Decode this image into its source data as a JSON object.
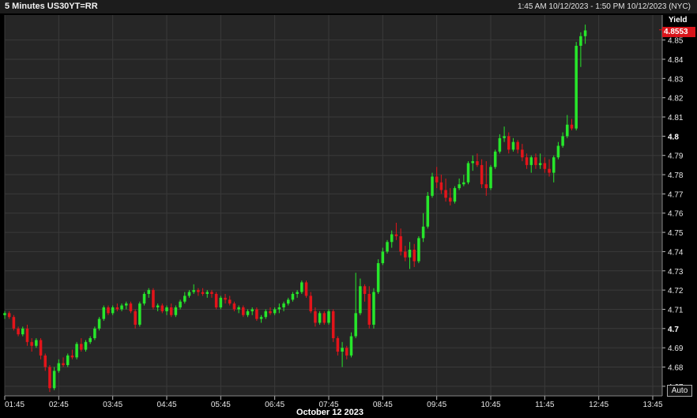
{
  "header": {
    "title": "5 Minutes US30YT=RR",
    "range": "1:45 AM 10/12/2023 - 1:50 PM 10/12/2023 (NYC)"
  },
  "axis": {
    "y_title": "Yield",
    "date_label": "October 12 2023",
    "auto_label": "Auto"
  },
  "last_price": {
    "value": "4.8553",
    "color": "#d9141a"
  },
  "colors": {
    "up": "#27e62b",
    "down": "#e3141a",
    "grid": "#3a3a3a",
    "plot_bg": "#262626"
  },
  "chart_data": {
    "type": "candlestick",
    "title": "5 Minutes US30YT=RR",
    "ylabel": "Yield",
    "xlabel": "October 12 2023",
    "ylim": [
      4.665,
      4.863
    ],
    "y_ticks": [
      "4.67",
      "4.68",
      "4.69",
      "4.7",
      "4.71",
      "4.72",
      "4.73",
      "4.74",
      "4.75",
      "4.76",
      "4.77",
      "4.78",
      "4.79",
      "4.8",
      "4.81",
      "4.82",
      "4.83",
      "4.84",
      "4.85"
    ],
    "x_ticks": [
      "01:45",
      "02:45",
      "03:45",
      "04:45",
      "05:45",
      "06:45",
      "07:45",
      "08:45",
      "09:45",
      "10:45",
      "11:45",
      "12:45",
      "13:45"
    ],
    "start_time": "01:45",
    "interval_minutes": 5,
    "candles": [
      [
        4.707,
        4.709,
        4.705,
        4.708
      ],
      [
        4.708,
        4.709,
        4.705,
        4.706
      ],
      [
        4.706,
        4.707,
        4.699,
        4.7
      ],
      [
        4.7,
        4.701,
        4.696,
        4.697
      ],
      [
        4.697,
        4.701,
        4.696,
        4.7
      ],
      [
        4.7,
        4.702,
        4.691,
        4.693
      ],
      [
        4.693,
        4.695,
        4.688,
        4.691
      ],
      [
        4.691,
        4.695,
        4.69,
        4.694
      ],
      [
        4.694,
        4.695,
        4.684,
        4.686
      ],
      [
        4.686,
        4.687,
        4.678,
        4.68
      ],
      [
        4.68,
        4.681,
        4.667,
        4.669
      ],
      [
        4.669,
        4.68,
        4.668,
        4.678
      ],
      [
        4.678,
        4.684,
        4.677,
        4.682
      ],
      [
        4.682,
        4.685,
        4.68,
        4.681
      ],
      [
        4.681,
        4.687,
        4.68,
        4.686
      ],
      [
        4.686,
        4.689,
        4.684,
        4.685
      ],
      [
        4.685,
        4.693,
        4.684,
        4.692
      ],
      [
        4.692,
        4.695,
        4.688,
        4.689
      ],
      [
        4.689,
        4.694,
        4.688,
        4.693
      ],
      [
        4.693,
        4.696,
        4.692,
        4.695
      ],
      [
        4.695,
        4.701,
        4.694,
        4.7
      ],
      [
        4.7,
        4.706,
        4.699,
        4.705
      ],
      [
        4.705,
        4.712,
        4.704,
        4.711
      ],
      [
        4.711,
        4.712,
        4.707,
        4.708
      ],
      [
        4.708,
        4.712,
        4.707,
        4.711
      ],
      [
        4.711,
        4.713,
        4.709,
        4.71
      ],
      [
        4.71,
        4.713,
        4.709,
        4.712
      ],
      [
        4.712,
        4.714,
        4.71,
        4.713
      ],
      [
        4.713,
        4.714,
        4.708,
        4.709
      ],
      [
        4.709,
        4.71,
        4.7,
        4.702
      ],
      [
        4.702,
        4.714,
        4.701,
        4.713
      ],
      [
        4.713,
        4.719,
        4.712,
        4.718
      ],
      [
        4.718,
        4.721,
        4.716,
        4.72
      ],
      [
        4.72,
        4.721,
        4.71,
        4.711
      ],
      [
        4.711,
        4.713,
        4.709,
        4.712
      ],
      [
        4.712,
        4.713,
        4.708,
        4.709
      ],
      [
        4.709,
        4.712,
        4.707,
        4.711
      ],
      [
        4.711,
        4.713,
        4.706,
        4.707
      ],
      [
        4.707,
        4.712,
        4.706,
        4.711
      ],
      [
        4.711,
        4.715,
        4.71,
        4.714
      ],
      [
        4.714,
        4.719,
        4.713,
        4.717
      ],
      [
        4.717,
        4.72,
        4.716,
        4.719
      ],
      [
        4.719,
        4.723,
        4.718,
        4.72
      ],
      [
        4.72,
        4.721,
        4.717,
        4.719
      ],
      [
        4.719,
        4.721,
        4.717,
        4.718
      ],
      [
        4.718,
        4.72,
        4.716,
        4.719
      ],
      [
        4.719,
        4.72,
        4.716,
        4.718
      ],
      [
        4.718,
        4.719,
        4.71,
        4.711
      ],
      [
        4.711,
        4.717,
        4.71,
        4.716
      ],
      [
        4.716,
        4.718,
        4.713,
        4.715
      ],
      [
        4.715,
        4.717,
        4.712,
        4.713
      ],
      [
        4.713,
        4.714,
        4.709,
        4.71
      ],
      [
        4.71,
        4.712,
        4.708,
        4.711
      ],
      [
        4.711,
        4.712,
        4.706,
        4.707
      ],
      [
        4.707,
        4.71,
        4.706,
        4.709
      ],
      [
        4.709,
        4.711,
        4.707,
        4.71
      ],
      [
        4.71,
        4.711,
        4.704,
        4.705
      ],
      [
        4.705,
        4.707,
        4.703,
        4.706
      ],
      [
        4.706,
        4.71,
        4.705,
        4.709
      ],
      [
        4.709,
        4.711,
        4.707,
        4.708
      ],
      [
        4.708,
        4.711,
        4.707,
        4.71
      ],
      [
        4.71,
        4.713,
        4.708,
        4.711
      ],
      [
        4.711,
        4.714,
        4.709,
        4.713
      ],
      [
        4.713,
        4.716,
        4.712,
        4.715
      ],
      [
        4.715,
        4.719,
        4.714,
        4.718
      ],
      [
        4.718,
        4.72,
        4.716,
        4.719
      ],
      [
        4.719,
        4.725,
        4.718,
        4.724
      ],
      [
        4.724,
        4.725,
        4.716,
        4.717
      ],
      [
        4.717,
        4.719,
        4.708,
        4.709
      ],
      [
        4.709,
        4.711,
        4.701,
        4.703
      ],
      [
        4.703,
        4.709,
        4.702,
        4.708
      ],
      [
        4.708,
        4.709,
        4.702,
        4.703
      ],
      [
        4.703,
        4.71,
        4.702,
        4.709
      ],
      [
        4.709,
        4.71,
        4.693,
        4.695
      ],
      [
        4.695,
        4.696,
        4.686,
        4.688
      ],
      [
        4.688,
        4.693,
        4.68,
        4.69
      ],
      [
        4.69,
        4.691,
        4.684,
        4.686
      ],
      [
        4.686,
        4.698,
        4.685,
        4.696
      ],
      [
        4.696,
        4.729,
        4.695,
        4.708
      ],
      [
        4.708,
        4.726,
        4.707,
        4.722
      ],
      [
        4.722,
        4.723,
        4.714,
        4.718
      ],
      [
        4.718,
        4.722,
        4.7,
        4.702
      ],
      [
        4.702,
        4.721,
        4.7,
        4.719
      ],
      [
        4.719,
        4.736,
        4.718,
        4.734
      ],
      [
        4.734,
        4.742,
        4.733,
        4.74
      ],
      [
        4.74,
        4.746,
        4.739,
        4.745
      ],
      [
        4.745,
        4.751,
        4.742,
        4.749
      ],
      [
        4.749,
        4.755,
        4.746,
        4.748
      ],
      [
        4.748,
        4.752,
        4.738,
        4.74
      ],
      [
        4.74,
        4.743,
        4.735,
        4.737
      ],
      [
        4.737,
        4.745,
        4.731,
        4.741
      ],
      [
        4.741,
        4.744,
        4.732,
        4.735
      ],
      [
        4.735,
        4.748,
        4.734,
        4.747
      ],
      [
        4.747,
        4.76,
        4.745,
        4.753
      ],
      [
        4.753,
        4.771,
        4.752,
        4.769
      ],
      [
        4.769,
        4.781,
        4.768,
        4.779
      ],
      [
        4.779,
        4.784,
        4.773,
        4.776
      ],
      [
        4.776,
        4.78,
        4.77,
        4.772
      ],
      [
        4.772,
        4.778,
        4.766,
        4.768
      ],
      [
        4.768,
        4.773,
        4.764,
        4.766
      ],
      [
        4.766,
        4.774,
        4.765,
        4.773
      ],
      [
        4.773,
        4.778,
        4.772,
        4.775
      ],
      [
        4.775,
        4.78,
        4.774,
        4.776
      ],
      [
        4.776,
        4.787,
        4.775,
        4.786
      ],
      [
        4.786,
        4.79,
        4.782,
        4.787
      ],
      [
        4.787,
        4.791,
        4.784,
        4.785
      ],
      [
        4.785,
        4.788,
        4.773,
        4.775
      ],
      [
        4.775,
        4.787,
        4.769,
        4.773
      ],
      [
        4.773,
        4.785,
        4.772,
        4.784
      ],
      [
        4.784,
        4.793,
        4.783,
        4.792
      ],
      [
        4.792,
        4.801,
        4.791,
        4.799
      ],
      [
        4.799,
        4.805,
        4.797,
        4.8
      ],
      [
        4.8,
        4.802,
        4.791,
        4.793
      ],
      [
        4.793,
        4.799,
        4.792,
        4.797
      ],
      [
        4.797,
        4.798,
        4.791,
        4.793
      ],
      [
        4.793,
        4.796,
        4.787,
        4.789
      ],
      [
        4.789,
        4.791,
        4.783,
        4.785
      ],
      [
        4.785,
        4.79,
        4.781,
        4.789
      ],
      [
        4.789,
        4.791,
        4.783,
        4.785
      ],
      [
        4.785,
        4.791,
        4.783,
        4.786
      ],
      [
        4.786,
        4.789,
        4.781,
        4.783
      ],
      [
        4.783,
        4.788,
        4.779,
        4.781
      ],
      [
        4.781,
        4.79,
        4.776,
        4.789
      ],
      [
        4.789,
        4.797,
        4.788,
        4.795
      ],
      [
        4.795,
        4.802,
        4.794,
        4.8
      ],
      [
        4.8,
        4.811,
        4.799,
        4.806
      ],
      [
        4.806,
        4.809,
        4.803,
        4.804
      ],
      [
        4.804,
        4.849,
        4.803,
        4.847
      ],
      [
        4.847,
        4.854,
        4.836,
        4.852
      ],
      [
        4.852,
        4.858,
        4.848,
        4.855
      ]
    ]
  }
}
